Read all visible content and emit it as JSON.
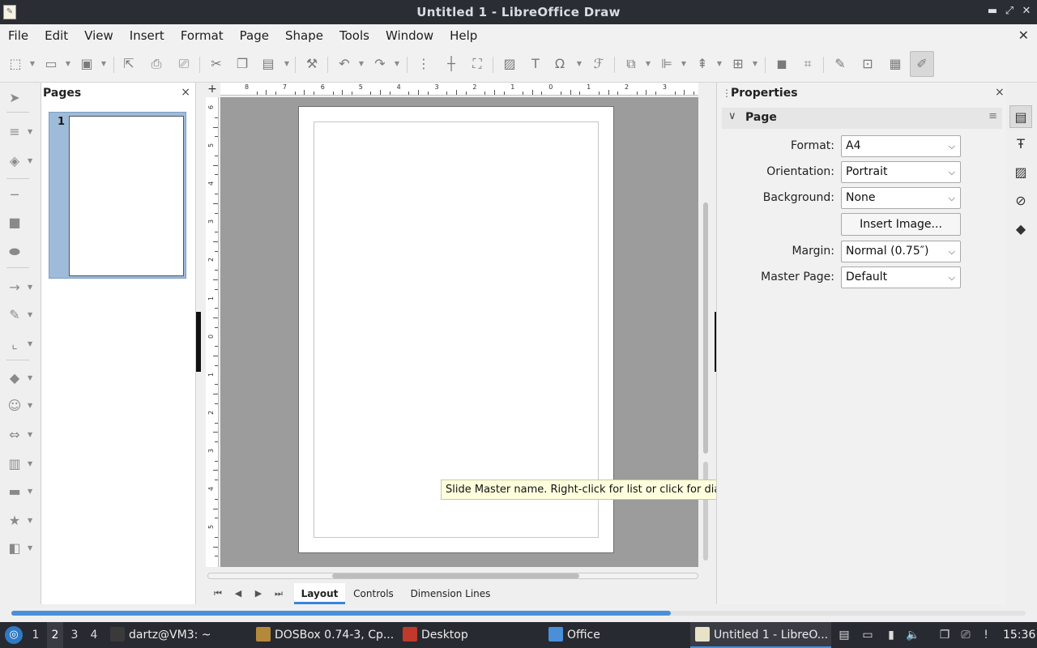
{
  "window": {
    "title": "Untitled 1 - LibreOffice Draw",
    "controls": {
      "minimize": "▬",
      "restore": "⤢",
      "close": "✕"
    }
  },
  "menu": [
    "File",
    "Edit",
    "View",
    "Insert",
    "Format",
    "Page",
    "Shape",
    "Tools",
    "Window",
    "Help"
  ],
  "pages_panel": {
    "title": "Pages",
    "close": "×",
    "page_number": "1"
  },
  "rulers": {
    "horizontal": [
      "8",
      "7",
      "6",
      "5",
      "4",
      "3",
      "2",
      "1",
      "0",
      "1",
      "2",
      "3"
    ],
    "vertical": [
      "6",
      "5",
      "4",
      "3",
      "2",
      "1",
      "0",
      "1",
      "2",
      "3",
      "4",
      "5"
    ]
  },
  "layer_tabs": [
    "Layout",
    "Controls",
    "Dimension Lines"
  ],
  "active_layer_tab": "Layout",
  "tooltip": "Slide Master name. Right-click for list or click for dialog.",
  "properties": {
    "title": "Properties",
    "close": "×",
    "section": "Page",
    "format": {
      "label": "Format:",
      "value": "A4"
    },
    "orientation": {
      "label": "Orientation:",
      "value": "Portrait"
    },
    "background": {
      "label": "Background:",
      "value": "None"
    },
    "insert_image": "Insert Image...",
    "margin": {
      "label": "Margin:",
      "value": "Normal (0.75″)"
    },
    "master_page": {
      "label": "Master Page:",
      "value": "Default"
    }
  },
  "progress": {
    "fraction": 0.65
  },
  "taskbar": {
    "workspaces": [
      "1",
      "2",
      "3",
      "4"
    ],
    "active_workspace": "2",
    "tasks": [
      {
        "label": "dartz@VM3: ~",
        "icon_color": "#3a3a3a"
      },
      {
        "label": "DOSBox 0.74-3, Cp...",
        "icon_color": "#b5893a"
      },
      {
        "label": "Desktop",
        "icon_color": "#c0392b"
      },
      {
        "label": "Office",
        "icon_color": "#4a8fd8"
      },
      {
        "label": "Untitled 1 - LibreO...",
        "icon_color": "#e8e2c8"
      }
    ],
    "clock": "15:36"
  },
  "colors": {
    "accent": "#4a90d9",
    "canvas": "#9c9c9c",
    "titlebar": "#2b2d35"
  }
}
